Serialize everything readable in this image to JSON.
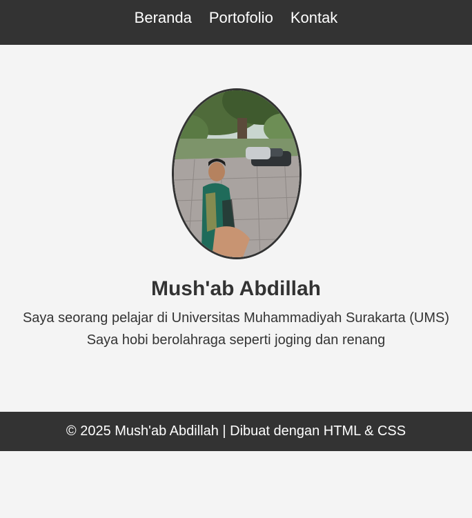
{
  "nav": {
    "items": [
      {
        "label": "Beranda"
      },
      {
        "label": "Portofolio"
      },
      {
        "label": "Kontak"
      }
    ]
  },
  "profile": {
    "name": "Mush'ab Abdillah",
    "bio_line1": "Saya seorang pelajar di Universitas Muhammadiyah Surakarta (UMS)",
    "bio_line2": "Saya hobi berolahraga seperti joging dan renang"
  },
  "footer": {
    "text": "© 2025 Mush'ab Abdillah | Dibuat dengan HTML & CSS"
  },
  "colors": {
    "header_bg": "#333333",
    "page_bg": "#f4f4f4",
    "text": "#333333"
  }
}
